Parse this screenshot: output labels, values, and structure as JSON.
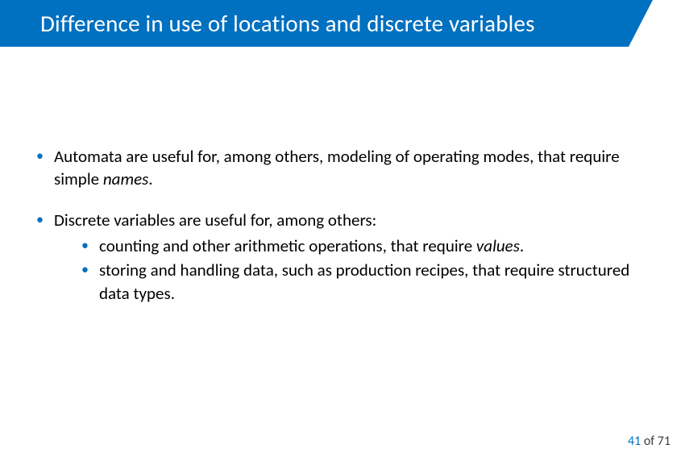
{
  "title": "Difference in use of locations and discrete variables",
  "bullets": [
    {
      "pre": "Automata are useful for, among others, modeling of operating modes, that require simple ",
      "em": "names",
      "post": "."
    },
    {
      "pre": "Discrete variables are useful for, among others:",
      "em": "",
      "post": "",
      "sub": [
        {
          "pre": "counting and other arithmetic operations, that require ",
          "em": "values",
          "post": "."
        },
        {
          "pre": "storing and handling data, such as production recipes, that require structured data types.",
          "em": "",
          "post": ""
        }
      ]
    }
  ],
  "page": {
    "current": "41",
    "sep": " of ",
    "total": "71"
  }
}
